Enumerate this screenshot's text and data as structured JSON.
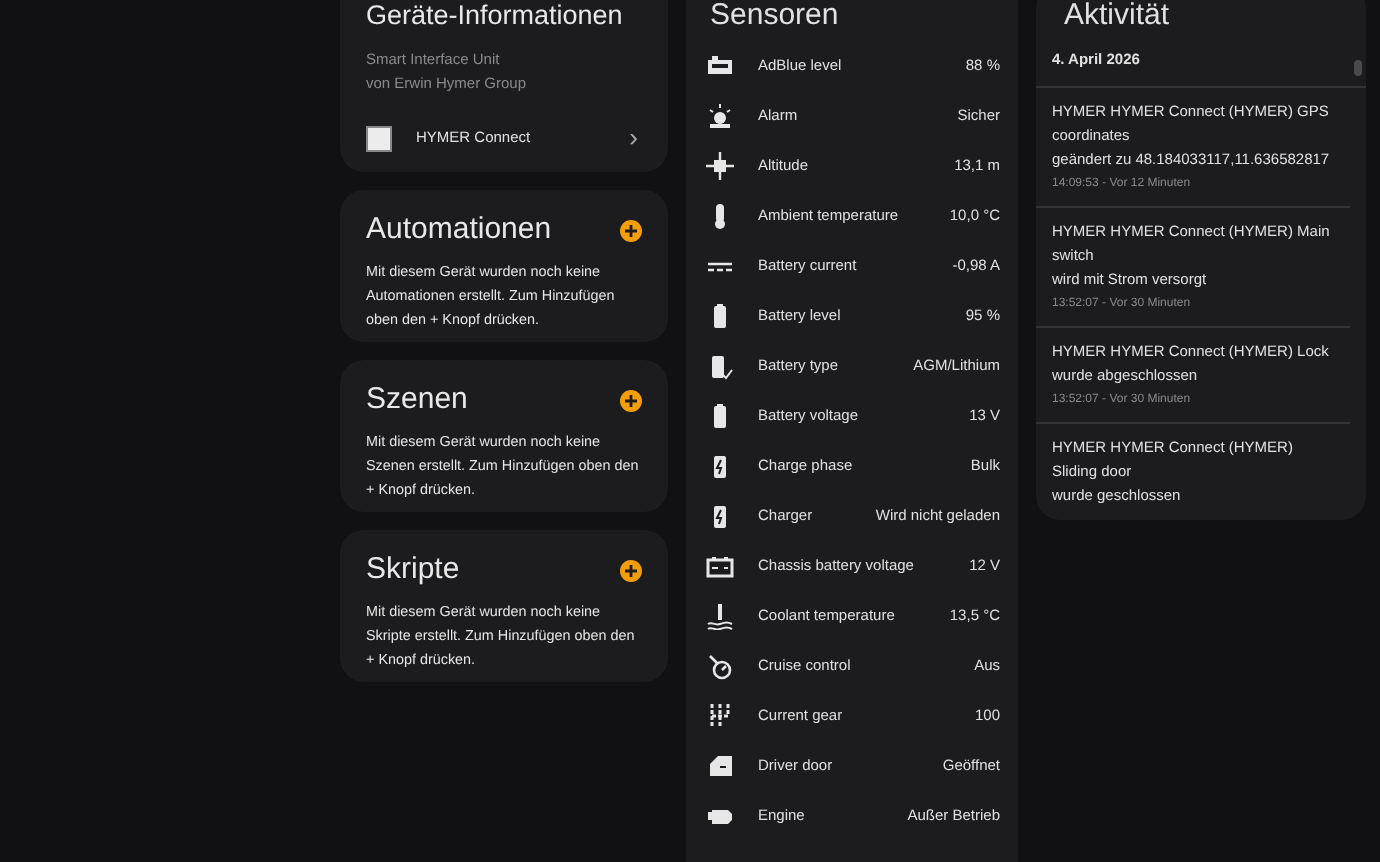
{
  "device_info": {
    "title": "Geräte-Informationen",
    "model": "Smart Interface Unit",
    "manufacturer": "von Erwin Hymer Group",
    "link": "HYMER Connect",
    "chevron": "›"
  },
  "sections": [
    {
      "title": "Automationen",
      "text": "Mit diesem Gerät wurden noch keine Automationen erstellt. Zum Hinzufügen oben den + Knopf drücken."
    },
    {
      "title": "Szenen",
      "text": "Mit diesem Gerät wurden noch keine Szenen erstellt. Zum Hinzufügen oben den + Knopf drücken."
    },
    {
      "title": "Skripte",
      "text": "Mit diesem Gerät wurden noch keine Skripte erstellt. Zum Hinzufügen oben den + Knopf drücken."
    }
  ],
  "sensors": {
    "title": "Sensoren",
    "rows": [
      {
        "label": "AdBlue level",
        "value": "88 %"
      },
      {
        "label": "Alarm",
        "value": "Sicher"
      },
      {
        "label": "Altitude",
        "value": "13,1 m"
      },
      {
        "label": "Ambient temperature",
        "value": "10,0 °C"
      },
      {
        "label": "Battery current",
        "value": "-0,98 A"
      },
      {
        "label": "Battery level",
        "value": "95 %"
      },
      {
        "label": "Battery type",
        "value": "AGM/Lithium"
      },
      {
        "label": "Battery voltage",
        "value": "13 V"
      },
      {
        "label": "Charge phase",
        "value": "Bulk"
      },
      {
        "label": "Charger",
        "value": "Wird nicht geladen"
      },
      {
        "label": "Chassis battery voltage",
        "value": "12 V"
      },
      {
        "label": "Coolant temperature",
        "value": "13,5 °C"
      },
      {
        "label": "Cruise control",
        "value": "Aus"
      },
      {
        "label": "Current gear",
        "value": "100"
      },
      {
        "label": "Driver door",
        "value": "Geöffnet"
      },
      {
        "label": "Engine",
        "value": "Außer Betrieb"
      }
    ]
  },
  "activity": {
    "title": "Aktivität",
    "date": "4. April 2026",
    "entries": [
      {
        "title": "HYMER HYMER Connect (HYMER) GPS coordinates",
        "detail": "geändert zu 48.184033117,11.636582817",
        "time": "14:09:53 - Vor 12 Minuten"
      },
      {
        "title": "HYMER HYMER Connect (HYMER) Main switch",
        "detail": "wird mit Strom versorgt",
        "time": "13:52:07 - Vor 30 Minuten"
      },
      {
        "title": "HYMER HYMER Connect (HYMER) Lock",
        "detail": "wurde abgeschlossen",
        "time": "13:52:07 - Vor 30 Minuten"
      },
      {
        "title": "HYMER HYMER Connect (HYMER) Sliding door",
        "detail": "wurde geschlossen"
      }
    ]
  }
}
